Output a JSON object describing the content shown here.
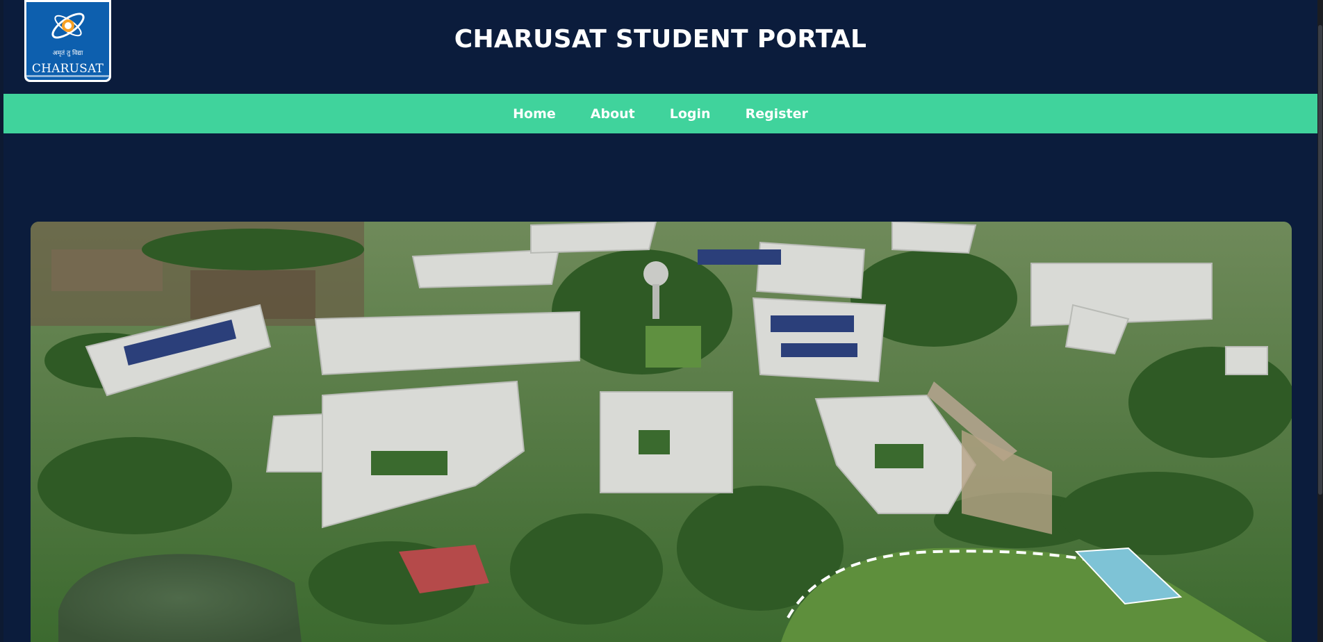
{
  "header": {
    "title": "CHARUSAT STUDENT PORTAL",
    "logo": {
      "name": "CHARUSAT",
      "motto": "अमृतं तु विद्या",
      "icon": "charusat-logo-emblem"
    }
  },
  "nav": {
    "items": [
      {
        "label": "Home"
      },
      {
        "label": "About"
      },
      {
        "label": "Login"
      },
      {
        "label": "Register"
      }
    ]
  },
  "hero": {
    "alt_icon": "campus-aerial-photo"
  },
  "colors": {
    "background": "#0b1c3c",
    "nav_bar": "#40d39c",
    "logo_blue": "#0d5fae",
    "text": "#ffffff"
  }
}
